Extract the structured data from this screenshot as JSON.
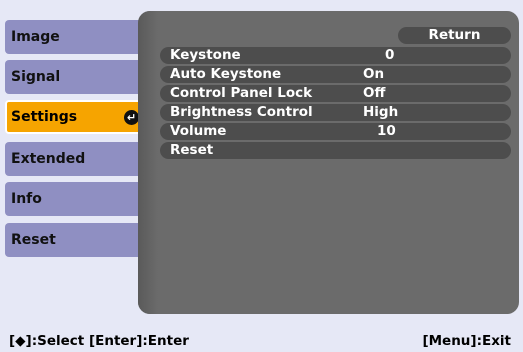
{
  "sidebar": {
    "items": [
      {
        "label": "Image"
      },
      {
        "label": "Signal"
      },
      {
        "label": "Settings",
        "selected": true
      },
      {
        "label": "Extended"
      },
      {
        "label": "Info"
      },
      {
        "label": "Reset"
      }
    ]
  },
  "main": {
    "return_label": "Return",
    "settings": [
      {
        "name": "Keystone",
        "value": "0"
      },
      {
        "name": "Auto Keystone",
        "value": "On"
      },
      {
        "name": "Control Panel Lock",
        "value": "Off"
      },
      {
        "name": "Brightness Control",
        "value": "High"
      },
      {
        "name": "Volume",
        "value": "10"
      },
      {
        "name": "Reset",
        "value": ""
      }
    ]
  },
  "status": {
    "left": "[◆]:Select  [Enter]:Enter",
    "right": "[Menu]:Exit"
  },
  "colors": {
    "tab": "#8f8fc2",
    "tab_selected": "#f6a400",
    "panel": "#6b6b6b",
    "row": "#4d4d4d"
  }
}
